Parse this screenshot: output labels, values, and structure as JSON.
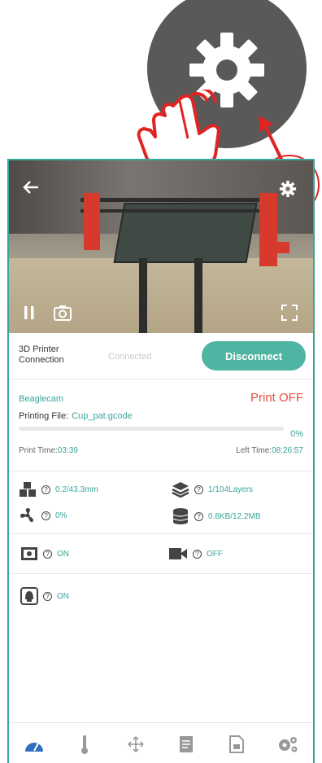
{
  "connection": {
    "label": "3D Printer Connection",
    "status": "Connected",
    "disconnect_label": "Disconnect"
  },
  "print": {
    "device": "Beaglecam",
    "status": "Print OFF",
    "file_label": "Printing File:",
    "file_name": "Cup_pat.gcode",
    "progress": 0,
    "progress_label": "0%",
    "print_time_label": "Print Time:",
    "print_time": "03:39",
    "left_time_label": "Left Time:",
    "left_time": "08:26:57"
  },
  "stats": {
    "filament": "0.2/43.3mm",
    "layers": "1/104Layers",
    "fan": "0%",
    "storage": "0.8KB/12.2MB"
  },
  "toggles": {
    "camera": "ON",
    "video": "OFF",
    "light": "ON"
  },
  "colors": {
    "accent": "#3aa59a",
    "danger": "#e74c3c",
    "nav_active": "#2f6fbf"
  },
  "nav": [
    {
      "icon": "dashboard-icon"
    },
    {
      "icon": "thermometer-icon"
    },
    {
      "icon": "move-icon"
    },
    {
      "icon": "files-icon"
    },
    {
      "icon": "gcode-icon"
    },
    {
      "icon": "settings-icon"
    }
  ]
}
